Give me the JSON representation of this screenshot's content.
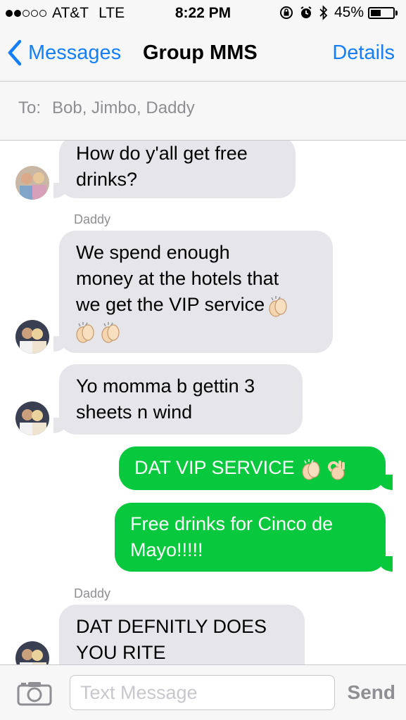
{
  "status_bar": {
    "carrier": "AT&T",
    "network": "LTE",
    "time": "8:22 PM",
    "battery_percent": "45%",
    "battery_level": 0.45,
    "signal_bars_filled": 2,
    "signal_bars_total": 5
  },
  "nav": {
    "back_label": "Messages",
    "title": "Group MMS",
    "details_label": "Details"
  },
  "to_bar": {
    "label": "To:",
    "recipients": "Bob, Jimbo, Daddy"
  },
  "messages": [
    {
      "direction": "incoming",
      "lines": [
        "How do y'all get free",
        "drinks?"
      ]
    },
    {
      "direction": "incoming",
      "sender": "Daddy",
      "lines": [
        "We spend enough",
        "money at the hotels that",
        "we get the VIP service",
        ""
      ],
      "emoji": [
        "clapping-hands",
        "clapping-hands",
        "clapping-hands"
      ]
    },
    {
      "direction": "incoming",
      "lines": [
        "Yo momma b gettin 3",
        "sheets n wind"
      ]
    },
    {
      "direction": "outgoing",
      "lines": [
        "DAT VIP SERVICE"
      ],
      "emoji": [
        "clapping-hands",
        "ok-hand"
      ]
    },
    {
      "direction": "outgoing",
      "lines": [
        "Free drinks for Cinco de",
        "Mayo!!!!!"
      ]
    },
    {
      "direction": "incoming",
      "sender": "Daddy",
      "lines": [
        "DAT DEFNITLY DOES",
        "YOU RITE"
      ]
    }
  ],
  "input_bar": {
    "placeholder": "Text Message",
    "send_label": "Send",
    "camera_icon": "camera-icon"
  },
  "colors": {
    "accent": "#157efb",
    "incoming_bubble": "#e5e5ea",
    "outgoing_bubble": "#08c83d",
    "bar_background": "#f7f7f7"
  }
}
